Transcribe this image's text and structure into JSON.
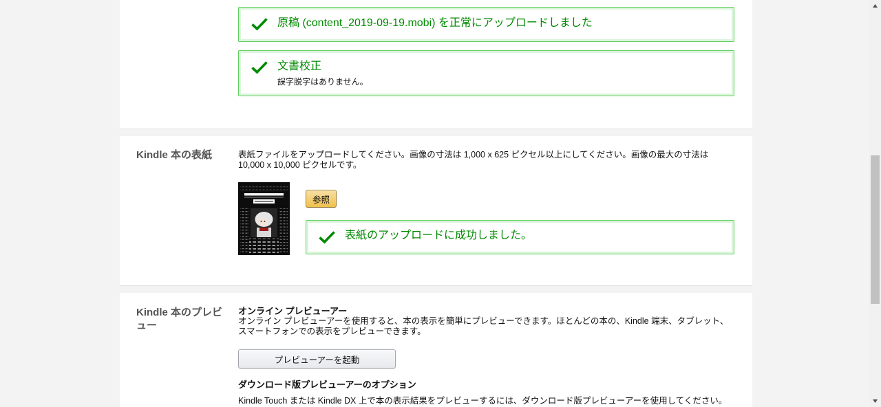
{
  "upload_section": {
    "manuscript_alert": {
      "icon": "check-icon",
      "message": "原稿 (content_2019-09-19.mobi) を正常にアップロードしました"
    },
    "spellcheck_alert": {
      "icon": "check-icon",
      "title": "文書校正",
      "message": "誤字脱字はありません。"
    }
  },
  "cover_section": {
    "label": "Kindle 本の表紙",
    "description": "表紙ファイルをアップロードしてください。画像の寸法は 1,000 x 625 ピクセル以上にしてください。画像の最大の寸法は 10,000 x 10,000 ピクセルです。",
    "browse_button": "参照",
    "success_alert": {
      "icon": "check-icon",
      "message": "表紙のアップロードに成功しました。"
    }
  },
  "preview_section": {
    "label": "Kindle 本のプレビュー",
    "online_previewer": {
      "title": "オンライン プレビューアー",
      "description": "オンライン プレビューアーを使用すると、本の表示を簡単にプレビューできます。ほとんどの本の、Kindle 端末、タブレット、スマートフォンでの表示をプレビューできます。",
      "launch_button": "プレビューアーを起動"
    },
    "download_previewer": {
      "title": "ダウンロード版プレビューアーのオプション",
      "description": "Kindle Touch または Kindle DX 上で本の表示結果をプレビューするには、ダウンロード版プレビューアーを使用してください。"
    }
  },
  "scrollbar": {
    "up_icon": "arrow-up-icon",
    "down_icon": "arrow-down-icon",
    "scroll_fraction": 0.61
  },
  "colors": {
    "page_background": "#f3f3f3",
    "panel_background": "#ffffff",
    "success_text": "#008a00",
    "success_border": "#62cf62",
    "success_inner": "#dcf5dc",
    "label_text": "#555555",
    "body_text": "#111111",
    "primary_button": "#f0c14b",
    "secondary_button": "#e7e9ec"
  }
}
